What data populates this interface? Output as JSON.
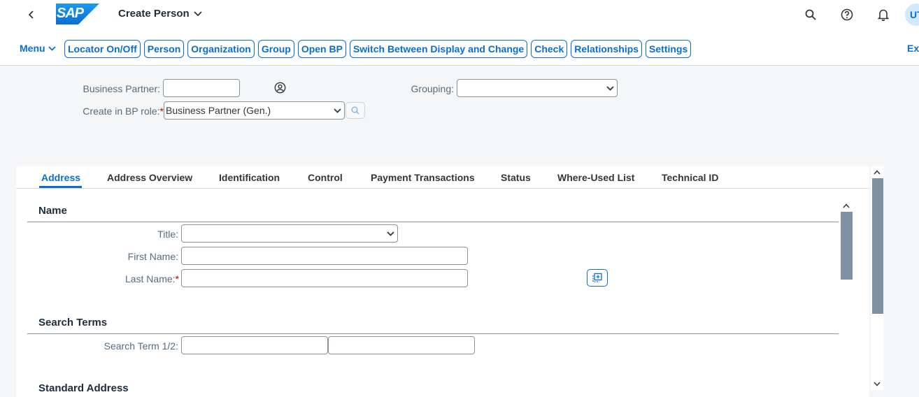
{
  "shell": {
    "logo_text": "SAP",
    "app_title": "Create Person",
    "avatar_initials": "UT"
  },
  "toolbar": {
    "menu_label": "Menu",
    "buttons": [
      "Locator On/Off",
      "Person",
      "Organization",
      "Group",
      "Open BP",
      "Switch Between Display and Change",
      "Check",
      "Relationships",
      "Settings"
    ],
    "exit_label": "Exit"
  },
  "header_form": {
    "business_partner_label": "Business Partner:",
    "business_partner_value": "",
    "grouping_label": "Grouping:",
    "grouping_value": "",
    "bp_role_label": "Create in BP role:",
    "bp_role_value": "Business Partner (Gen.)"
  },
  "tabs": [
    "Address",
    "Address Overview",
    "Identification",
    "Control",
    "Payment Transactions",
    "Status",
    "Where-Used List",
    "Technical ID"
  ],
  "name_section": {
    "title": "Name",
    "title_label": "Title:",
    "title_value": "",
    "first_name_label": "First Name:",
    "first_name_value": "",
    "last_name_label": "Last Name:",
    "last_name_value": ""
  },
  "search_terms": {
    "title": "Search Terms",
    "label": "Search Term 1/2:",
    "term1": "",
    "term2": ""
  },
  "standard_address": {
    "title": "Standard Address"
  },
  "colors": {
    "accent": "#0a6ed1",
    "required": "#bb0000",
    "scroll_thumb": "#7f91a3"
  }
}
